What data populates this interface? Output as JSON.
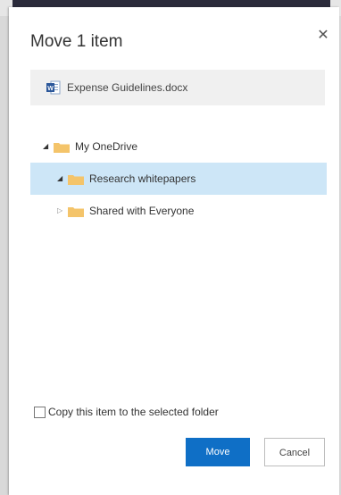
{
  "dialog": {
    "title": "Move 1 item",
    "close_icon": "close-icon"
  },
  "file": {
    "name": "Expense Guidelines.docx",
    "icon": "word-document-icon"
  },
  "tree": [
    {
      "label": "My OneDrive",
      "level": 0,
      "expanded": true,
      "selected": false
    },
    {
      "label": "Research whitepapers",
      "level": 1,
      "expanded": true,
      "selected": true
    },
    {
      "label": "Shared with Everyone",
      "level": 1,
      "expanded": false,
      "selected": false
    }
  ],
  "copy_option": {
    "label": "Copy this item to the selected folder",
    "checked": false
  },
  "buttons": {
    "move_label": "Move",
    "cancel_label": "Cancel"
  },
  "colors": {
    "primary": "#0f6fc6",
    "selection": "#cde6f7",
    "folder": "#f4c46a",
    "word": "#2b579a"
  }
}
